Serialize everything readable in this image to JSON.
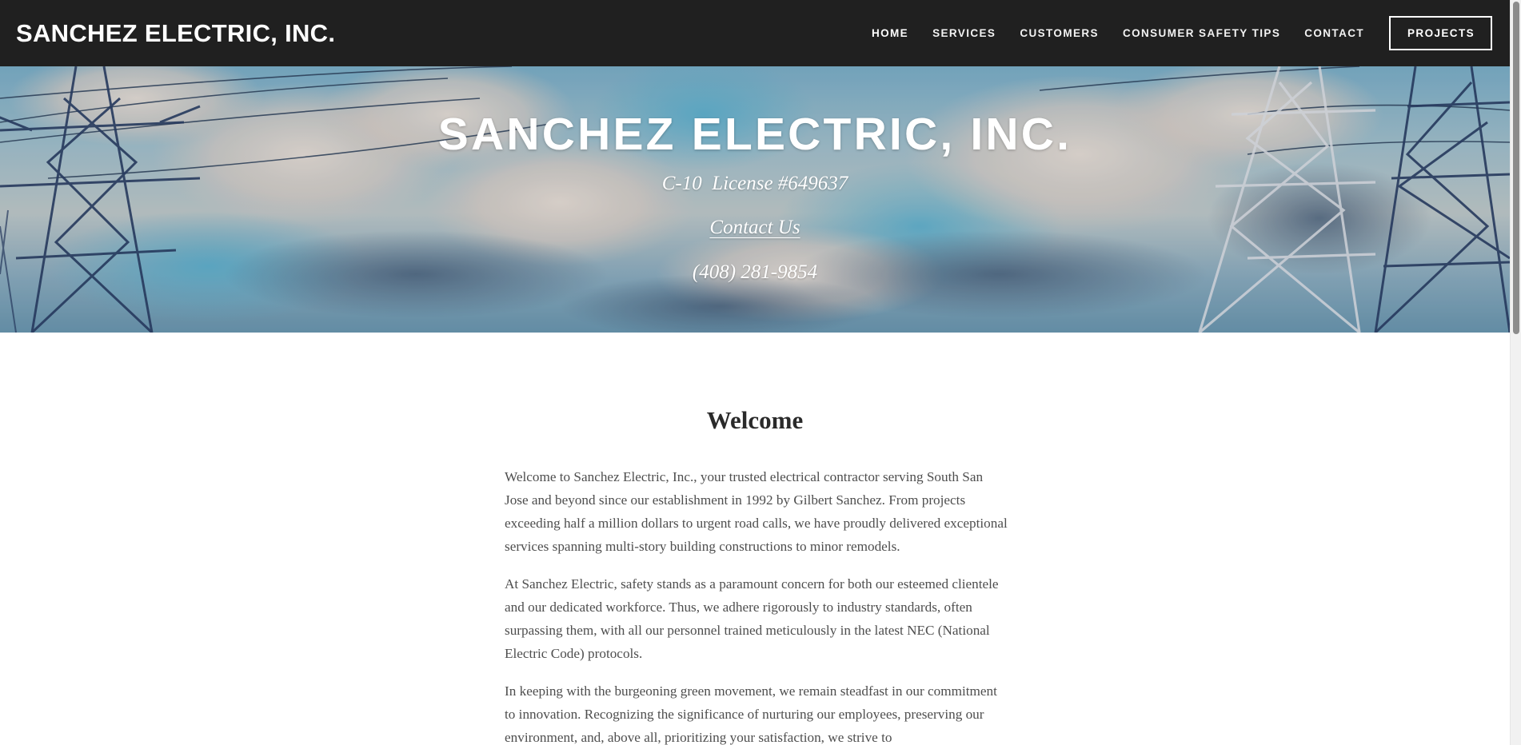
{
  "header": {
    "site_title": "SANCHEZ ELECTRIC, INC.",
    "nav": [
      {
        "label": "HOME",
        "active": true
      },
      {
        "label": "SERVICES",
        "active": false
      },
      {
        "label": "CUSTOMERS",
        "active": false
      },
      {
        "label": "CONSUMER SAFETY TIPS",
        "active": false
      },
      {
        "label": "CONTACT",
        "active": false
      }
    ],
    "cta_label": "PROJECTS"
  },
  "hero": {
    "title": "SANCHEZ ELECTRIC, INC.",
    "license": "C-10  License #649637",
    "contact_link": "Contact Us",
    "phone": "(408) 281-9854"
  },
  "main": {
    "heading": "Welcome",
    "paragraphs": [
      "Welcome to Sanchez Electric, Inc., your trusted electrical contractor serving South San Jose and beyond since our establishment in 1992 by Gilbert Sanchez. From projects exceeding half a million dollars to urgent road calls, we have proudly delivered exceptional services spanning multi-story building constructions to minor remodels.",
      "At Sanchez Electric, safety stands as a paramount concern for both our esteemed clientele and our dedicated workforce. Thus, we adhere rigorously to industry standards, often surpassing them, with all our personnel trained meticulously in the latest NEC (National Electric Code) protocols.",
      "In keeping with the burgeoning green movement, we remain steadfast in our commitment to innovation. Recognizing the significance of nurturing our employees, preserving our environment, and, above all, prioritizing your satisfaction, we strive to"
    ]
  },
  "colors": {
    "header_bg": "#202020",
    "heading_text": "#2a2a2a",
    "body_text": "#4e4e4e"
  }
}
